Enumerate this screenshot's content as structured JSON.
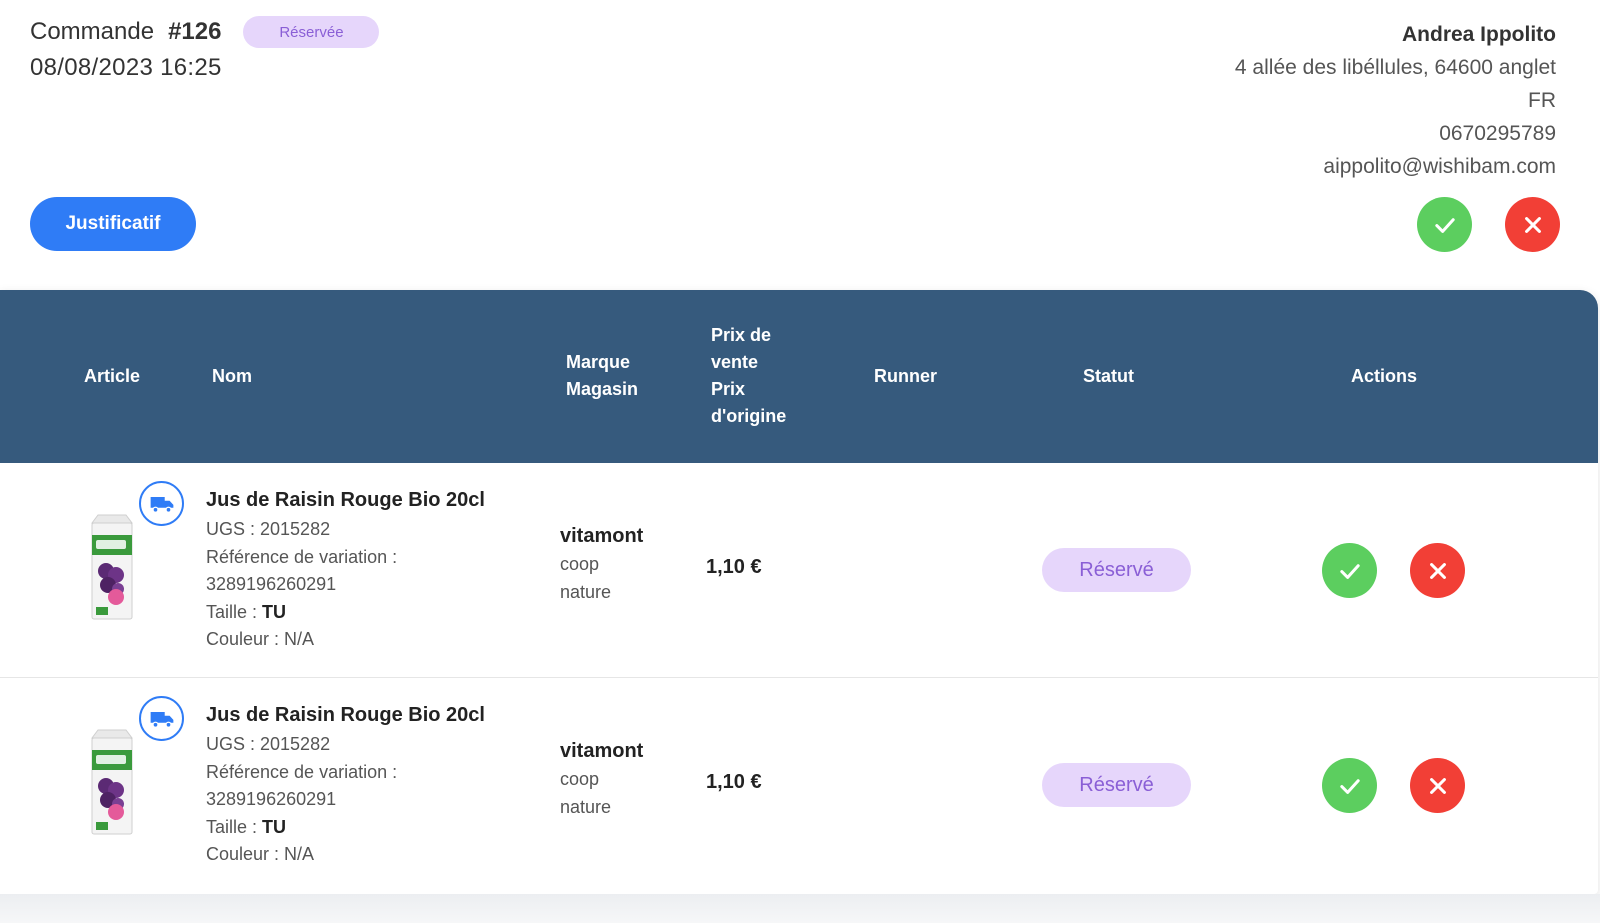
{
  "order": {
    "label": "Commande",
    "number": "#126",
    "status": "Réservée",
    "date": "08/08/2023 16:25"
  },
  "customer": {
    "name": "Andrea Ippolito",
    "address": "4 allée des libéllules, 64600 anglet",
    "country": "FR",
    "phone": "0670295789",
    "email": "aippolito@wishibam.com"
  },
  "buttons": {
    "justificatif": "Justificatif"
  },
  "colors": {
    "header_bg": "#365a7d",
    "primary": "#2f7cf6",
    "accept": "#5cce5f",
    "reject": "#f23f36",
    "status_bg": "#e6d6fb",
    "status_text": "#8a5fd6"
  },
  "icons": {
    "accept": "check-icon",
    "reject": "close-icon",
    "delivery": "truck-icon"
  },
  "table": {
    "headers": {
      "article": "Article",
      "nom": "Nom",
      "marque": "Marque",
      "magasin": "Magasin",
      "prix_vente_1": "Prix de",
      "prix_vente_2": "vente",
      "prix_origine_1": "Prix",
      "prix_origine_2": "d'origine",
      "runner": "Runner",
      "statut": "Statut",
      "actions": "Actions"
    },
    "rows": [
      {
        "name": "Jus de Raisin Rouge Bio 20cl",
        "ugs": "UGS : 2015282",
        "variation_label": "Référence de variation :",
        "variation_value": "3289196260291",
        "size_label": "Taille :",
        "size_value": "TU",
        "color": "Couleur : N/A",
        "brand": "vitamont",
        "store_1": "coop",
        "store_2": "nature",
        "price": "1,10 €",
        "runner": "",
        "status": "Réservé"
      },
      {
        "name": "Jus de Raisin Rouge Bio 20cl",
        "ugs": "UGS : 2015282",
        "variation_label": "Référence de variation :",
        "variation_value": "3289196260291",
        "size_label": "Taille :",
        "size_value": "TU",
        "color": "Couleur : N/A",
        "brand": "vitamont",
        "store_1": "coop",
        "store_2": "nature",
        "price": "1,10 €",
        "runner": "",
        "status": "Réservé"
      }
    ]
  }
}
